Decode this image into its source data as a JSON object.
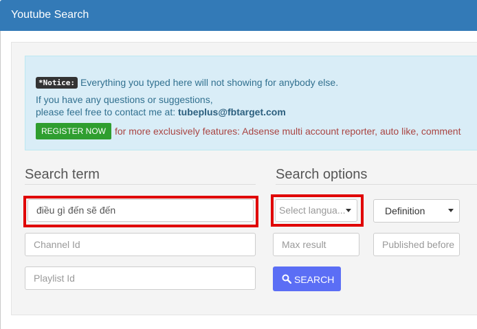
{
  "header": {
    "title": "Youtube Search"
  },
  "notice": {
    "badge": "*Notice:",
    "line1": "Everything you typed here will not showing for anybody else.",
    "line2": "If you have any questions or suggestions,",
    "line3_prefix": "please feel free to contact me at: ",
    "email": "tubeplus@fbtarget.com",
    "register_button": "REGISTER NOW",
    "register_text": "for more exclusively features: Adsense multi account reporter, auto like, comment"
  },
  "search_term": {
    "title": "Search term",
    "query_value": "điều gì đến sẽ đến",
    "channel_placeholder": "Channel Id",
    "playlist_placeholder": "Playlist Id"
  },
  "search_options": {
    "title": "Search options",
    "language_placeholder": "Select langua...",
    "definition_value": "Definition",
    "max_result_placeholder": "Max result",
    "published_placeholder": "Published before",
    "search_button": "SEARCH"
  },
  "colors": {
    "header": "#337ab7",
    "notice_bg": "#d9edf7",
    "register_button": "#2f9e2f",
    "search_button": "#5b6ef5",
    "highlight": "#e00000"
  }
}
